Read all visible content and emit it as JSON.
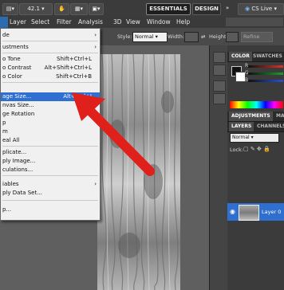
{
  "appbar": {
    "zoom": "42.1",
    "essentials": "ESSENTIALS",
    "design": "DESIGN",
    "more": "»",
    "cslive": "CS Live"
  },
  "menubar": [
    "Layer",
    "Select",
    "Filter",
    "Analysis",
    "3D",
    "View",
    "Window",
    "Help"
  ],
  "options": {
    "style_label": "Style:",
    "style_value": "Normal",
    "width_label": "Width:",
    "height_label": "Height:",
    "refine": "Refine"
  },
  "menu": {
    "items": [
      {
        "t": "de",
        "k": "",
        "sub": "›"
      },
      {
        "t": "ustments",
        "k": "",
        "sub": "›"
      },
      {
        "t": "o Tone",
        "k": "Shift+Ctrl+L"
      },
      {
        "t": "o Contrast",
        "k": "Alt+Shift+Ctrl+L"
      },
      {
        "t": "o Color",
        "k": "Shift+Ctrl+B"
      },
      {
        "t": "age Size...",
        "k": "Alt+Ctrl+I"
      },
      {
        "t": "nvas Size...",
        "k": "Alt+"
      },
      {
        "t": "ge Rotation",
        "k": "",
        "sub": "›"
      },
      {
        "t": "p",
        "k": ""
      },
      {
        "t": "m",
        "k": ""
      },
      {
        "t": "eal All",
        "k": ""
      },
      {
        "t": "plicate...",
        "k": ""
      },
      {
        "t": "ply Image...",
        "k": ""
      },
      {
        "t": "culations...",
        "k": ""
      },
      {
        "t": "iables",
        "k": "",
        "sub": "›"
      },
      {
        "t": "ply Data Set...",
        "k": ""
      },
      {
        "t": "p...",
        "k": ""
      }
    ]
  },
  "panels": {
    "color_tab": "COLOR",
    "swatches_tab": "SWATCHES",
    "adj_tab": "ADJUSTMENTS",
    "masks_tab": "MAS",
    "layers_tab": "LAYERS",
    "channels_tab": "CHANNELS",
    "blend": "Normal",
    "lock": "Lock:",
    "layer_name": "Layer 0",
    "colors": {
      "r": "#e0302a",
      "g": "#1c9c2a",
      "b": "#2452d6"
    }
  }
}
